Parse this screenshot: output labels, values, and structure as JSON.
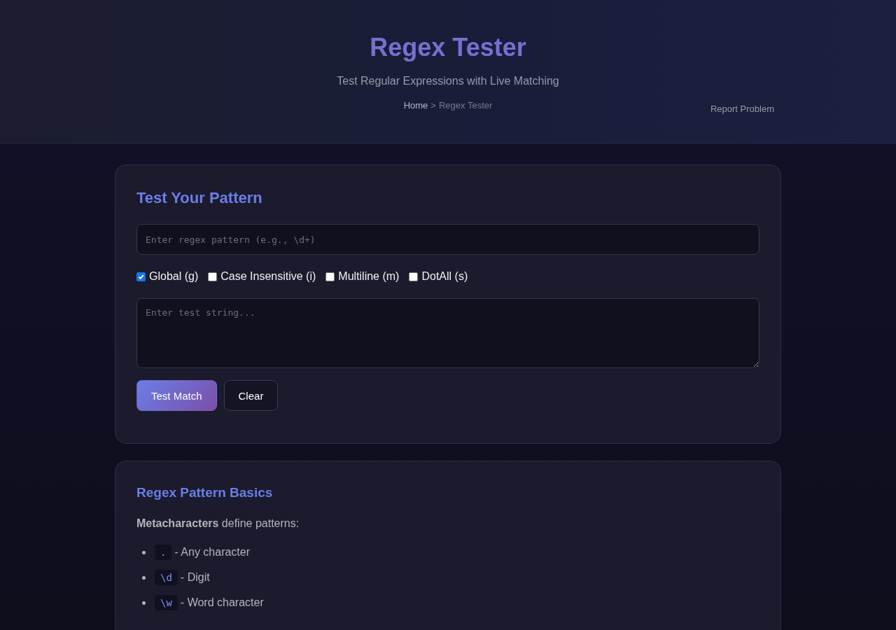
{
  "header": {
    "title": "Regex Tester",
    "subtitle": "Test Regular Expressions with Live Matching",
    "breadcrumb": [
      {
        "label": "Home",
        "kind": "link"
      },
      {
        "label": ">",
        "kind": "separator"
      },
      {
        "label": "Regex Tester",
        "kind": "current"
      }
    ],
    "report_link": "Report Problem"
  },
  "tester": {
    "heading": "Test Your Pattern",
    "pattern": {
      "placeholder": "Enter regex pattern (e.g., \\d+)"
    },
    "flags": [
      {
        "label": "Global (g)",
        "checked": true
      },
      {
        "label": "Case Insensitive (i)",
        "checked": false
      },
      {
        "label": "Multiline (m)",
        "checked": false
      },
      {
        "label": "DotAll (s)",
        "checked": false
      }
    ],
    "test_string": {
      "placeholder": "Enter test string..."
    },
    "buttons": [
      {
        "label": "Test Match",
        "kind": "primary"
      },
      {
        "label": "Clear",
        "kind": "secondary"
      }
    ]
  },
  "basics": {
    "heading": "Regex Pattern Basics",
    "intro": "**Metacharacters** define patterns:",
    "items": [
      {
        "code": ".",
        "description": "- Any character"
      },
      {
        "code": "\\d",
        "description": "- Digit"
      },
      {
        "code": "\\w",
        "description": "- Word character"
      }
    ]
  }
}
